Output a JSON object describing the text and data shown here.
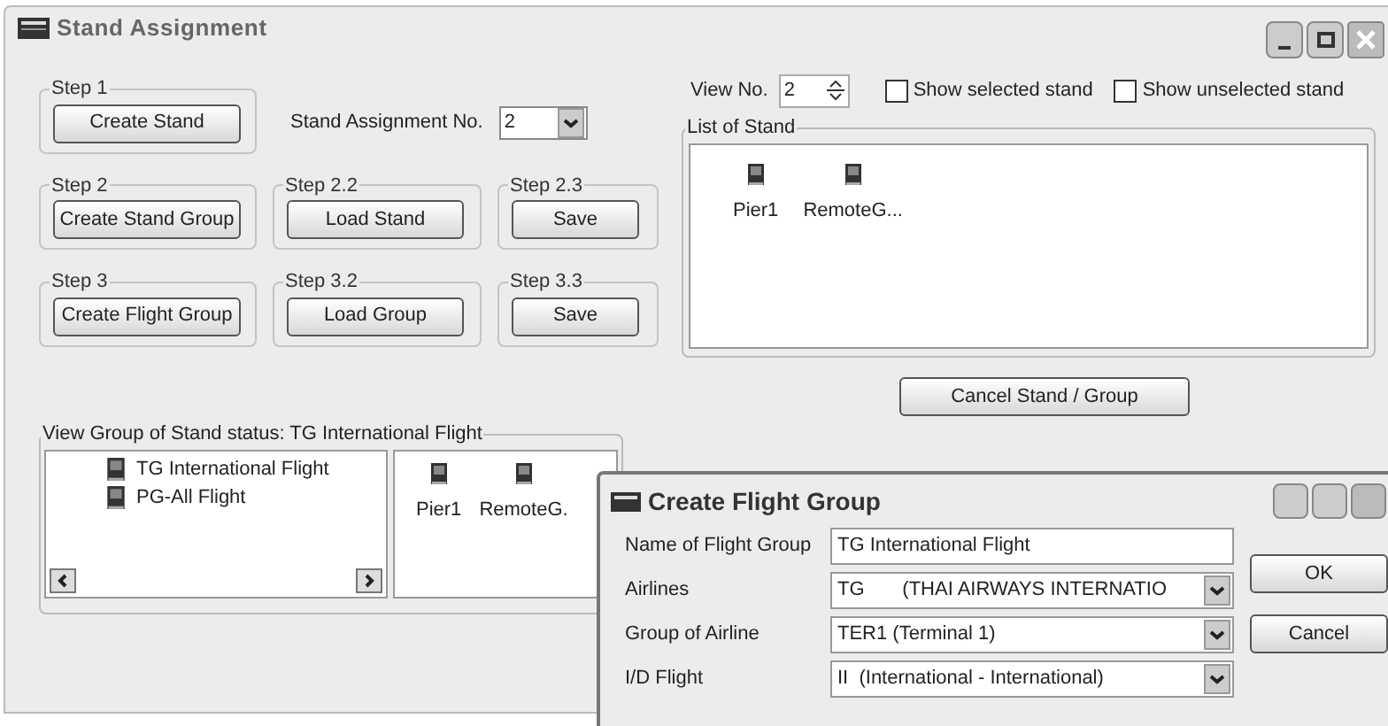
{
  "window": {
    "title": "Stand Assignment"
  },
  "step_rows": [
    [
      {
        "label": "Step 1",
        "button": "Create Stand"
      }
    ],
    [
      {
        "label": "Step 2",
        "button": "Create Stand Group"
      },
      {
        "label": "Step 2.2",
        "button": "Load Stand"
      },
      {
        "label": "Step 2.3",
        "button": "Save"
      }
    ],
    [
      {
        "label": "Step 3",
        "button": "Create Flight Group"
      },
      {
        "label": "Step 3.2",
        "button": "Load Group"
      },
      {
        "label": "Step 3.3",
        "button": "Save"
      }
    ]
  ],
  "assignment_no": {
    "label": "Stand Assignment No.",
    "value": "2"
  },
  "view_no": {
    "label": "View No.",
    "value": "2"
  },
  "checkboxes": [
    {
      "label": "Show selected stand",
      "checked": false
    },
    {
      "label": "Show unselected stand",
      "checked": false
    }
  ],
  "list_of_stand": {
    "title": "List of Stand",
    "items": [
      "Pier1",
      "RemoteG..."
    ]
  },
  "cancel_button": "Cancel Stand / Group",
  "view_group": {
    "title": "View Group of Stand status: TG International Flight",
    "groups": [
      "TG International Flight",
      "PG-All Flight"
    ],
    "stands": [
      "Pier1",
      "RemoteG."
    ]
  },
  "dialog": {
    "title": "Create Flight Group",
    "fields": [
      {
        "label": "Name of Flight Group",
        "kind": "text",
        "value": "TG International Flight"
      },
      {
        "label": "Airlines",
        "kind": "dropdown",
        "value": "TG       (THAI AIRWAYS INTERNATIO"
      },
      {
        "label": "Group of Airline",
        "kind": "dropdown",
        "value": "TER1 (Terminal 1)"
      },
      {
        "label": "I/D Flight",
        "kind": "dropdown",
        "value": "II  (International - International)"
      }
    ],
    "buttons": [
      "OK",
      "Cancel"
    ]
  }
}
